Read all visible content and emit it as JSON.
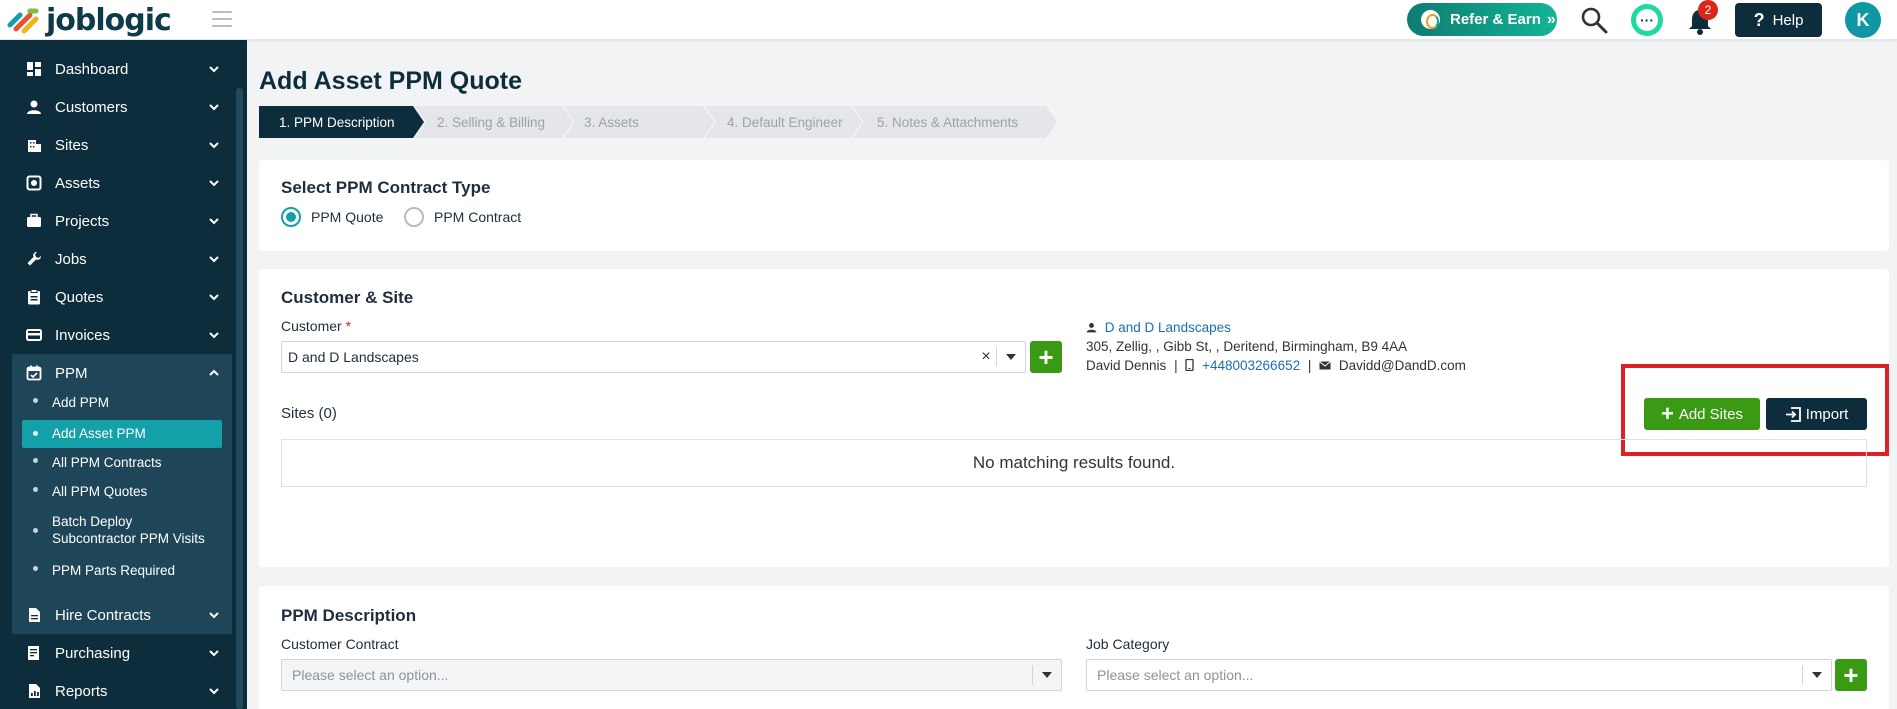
{
  "topbar": {
    "logo_text": "joblogic",
    "refer_label": "Refer & Earn",
    "notification_count": "2",
    "help_label": "Help",
    "avatar_initial": "K"
  },
  "sidebar": {
    "items": [
      {
        "label": "Dashboard",
        "icon": "dashboard-icon"
      },
      {
        "label": "Customers",
        "icon": "person-icon"
      },
      {
        "label": "Sites",
        "icon": "building-icon"
      },
      {
        "label": "Assets",
        "icon": "asset-icon"
      },
      {
        "label": "Projects",
        "icon": "briefcase-icon"
      },
      {
        "label": "Jobs",
        "icon": "wrench-icon"
      },
      {
        "label": "Quotes",
        "icon": "clipboard-icon"
      },
      {
        "label": "Invoices",
        "icon": "card-icon"
      },
      {
        "label": "PPM",
        "icon": "calendar-icon"
      }
    ],
    "ppm_sub": [
      {
        "label": "Add PPM"
      },
      {
        "label": "Add Asset PPM"
      },
      {
        "label": "All PPM Contracts"
      },
      {
        "label": "All PPM Quotes"
      },
      {
        "label": "Batch Deploy Subcontractor PPM Visits"
      },
      {
        "label": "PPM Parts Required"
      }
    ],
    "bottom_items": [
      {
        "label": "Hire Contracts",
        "icon": "document-icon"
      },
      {
        "label": "Purchasing",
        "icon": "cart-icon"
      },
      {
        "label": "Reports",
        "icon": "report-icon"
      }
    ]
  },
  "page": {
    "title": "Add Asset PPM Quote",
    "steps": [
      {
        "label": "1. PPM Description",
        "active": true
      },
      {
        "label": "2. Selling & Billing",
        "active": false
      },
      {
        "label": "3. Assets",
        "active": false
      },
      {
        "label": "4. Default Engineer",
        "active": false
      },
      {
        "label": "5. Notes & Attachments",
        "active": false
      }
    ]
  },
  "contract_type": {
    "title": "Select PPM Contract Type",
    "options": [
      {
        "label": "PPM Quote",
        "selected": true
      },
      {
        "label": "PPM Contract",
        "selected": false
      }
    ]
  },
  "customer_site": {
    "title": "Customer & Site",
    "customer_label": "Customer",
    "required_mark": "*",
    "customer_value": "D and D Landscapes",
    "clear_glyph": "×",
    "add_glyph": "+",
    "info": {
      "name": "D and D Landscapes",
      "address": "305, Zellig, , Gibb St, , Deritend, Birmingham, B9 4AA",
      "contact": "David Dennis",
      "separator": "|",
      "phone": "+448003266652",
      "email": "Davidd@DandD.com"
    },
    "sites_label": "Sites (0)",
    "add_sites_label": "Add Sites",
    "import_label": "Import",
    "empty_text": "No matching results found."
  },
  "ppm_description": {
    "title": "PPM Description",
    "customer_contract_label": "Customer Contract",
    "customer_contract_placeholder": "Please select an option...",
    "job_category_label": "Job Category",
    "job_category_placeholder": "Please select an option..."
  },
  "colors": {
    "sidebar_bg": "#0d2d3d",
    "active_teal": "#13a0a9",
    "green": "#3a9a14",
    "highlight_red": "#e11f26"
  }
}
